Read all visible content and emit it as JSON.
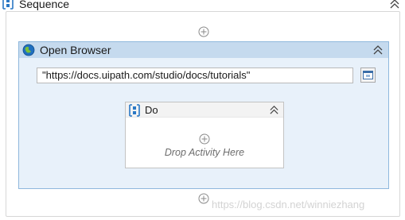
{
  "sequence": {
    "title": "Sequence"
  },
  "open_browser": {
    "title": "Open Browser",
    "url_value": "\"https://docs.uipath.com/studio/docs/tutorials\""
  },
  "do_block": {
    "title": "Do",
    "drop_hint": "Drop Activity Here"
  },
  "watermark": "https://blog.csdn.net/winniezhang",
  "colors": {
    "activity_header": "#c5daee",
    "activity_body": "#e8f1fa",
    "activity_border": "#8fb8dd",
    "sequence_icon_blue": "#2b78c5",
    "globe_blue": "#1f6fbf",
    "globe_green": "#7bbf3a"
  },
  "icons": {
    "sequence": "sequence-icon",
    "open_browser": "globe-icon",
    "do": "sequence-icon",
    "collapse": "double-chevron-up-icon",
    "add": "plus-circle-icon",
    "browse": "browser-window-icon"
  }
}
